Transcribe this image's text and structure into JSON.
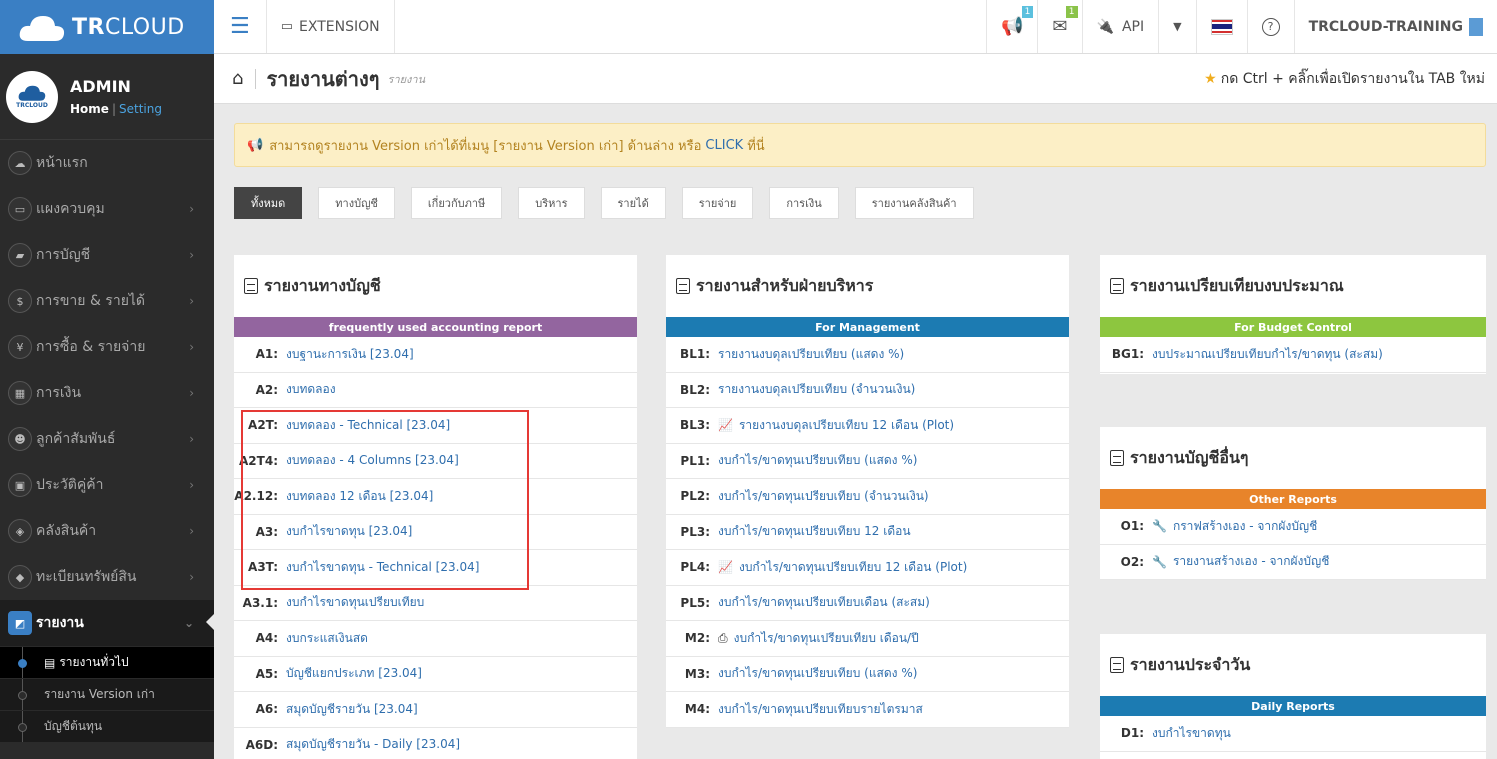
{
  "brand": {
    "bold": "TR",
    "light": "CLOUD",
    "avatar_text": "TRCLOUD"
  },
  "profile": {
    "name": "ADMIN",
    "home": "Home",
    "separator": "|",
    "setting": "Setting"
  },
  "sidebar": {
    "items": [
      {
        "label": "หน้าแรก",
        "icon": "cloud-icon",
        "glyph": "☁"
      },
      {
        "label": "แผงควบคุม",
        "icon": "monitor-icon",
        "glyph": "▭"
      },
      {
        "label": "การบัญชี",
        "icon": "book-icon",
        "glyph": "▰"
      },
      {
        "label": "การขาย & รายได้",
        "icon": "dollar-icon",
        "glyph": "$"
      },
      {
        "label": "การซื้อ & รายจ่าย",
        "icon": "yen-icon",
        "glyph": "¥"
      },
      {
        "label": "การเงิน",
        "icon": "calendar-icon",
        "glyph": "▦"
      },
      {
        "label": "ลูกค้าสัมพันธ์",
        "icon": "users-icon",
        "glyph": "☻"
      },
      {
        "label": "ประวัติคู่ค้า",
        "icon": "contact-icon",
        "glyph": "▣"
      },
      {
        "label": "คลังสินค้า",
        "icon": "cubes-icon",
        "glyph": "◈"
      },
      {
        "label": "ทะเบียนทรัพย์สิน",
        "icon": "diamond-icon",
        "glyph": "◆"
      }
    ],
    "active": {
      "label": "รายงาน",
      "icon": "report-icon",
      "glyph": "◩"
    },
    "submenu": [
      {
        "label": "รายงานทั่วไป",
        "current": true
      },
      {
        "label": "รายงาน Version เก่า",
        "current": false
      },
      {
        "label": "บัญชีต้นทุน",
        "current": false
      }
    ]
  },
  "topbar": {
    "extension": "EXTENSION",
    "announce_count": "1",
    "mail_count": "1",
    "api": "API",
    "company": "TRCLOUD-TRAINING"
  },
  "page": {
    "title": "รายงานต่างๆ",
    "subtitle": "รายงาน",
    "hint": "กด Ctrl + คลิ๊กเพื่อเปิดรายงานใน TAB ใหม่"
  },
  "notice": {
    "text": "สามารถดูรายงาน Version เก่าได้ที่เมนู [รายงาน Version เก่า] ด้านล่าง หรือ",
    "link": "CLICK",
    "tail": "ที่นี่"
  },
  "filters": [
    "ทั้งหมด",
    "ทางบัญชี",
    "เกี่ยวกับภาษี",
    "บริหาร",
    "รายได้",
    "รายจ่าย",
    "การเงิน",
    "รายงานคลังสินค้า"
  ],
  "panels": {
    "accounting": {
      "title": "รายงานทางบัญชี",
      "band": "frequently used accounting report",
      "band_color": "#93659f",
      "rows": [
        {
          "code": "A1:",
          "label": "งบฐานะการเงิน [23.04]"
        },
        {
          "code": "A2:",
          "label": "งบทดลอง"
        },
        {
          "code": "A2T:",
          "label": "งบทดลอง - Technical [23.04]"
        },
        {
          "code": "A2T4:",
          "label": "งบทดลอง - 4 Columns [23.04]"
        },
        {
          "code": "A2.12:",
          "label": "งบทดลอง 12 เดือน [23.04]"
        },
        {
          "code": "A3:",
          "label": "งบกำไรขาดทุน [23.04]"
        },
        {
          "code": "A3T:",
          "label": "งบกำไรขาดทุน - Technical [23.04]"
        },
        {
          "code": "A3.1:",
          "label": "งบกำไรขาดทุนเปรียบเทียบ"
        },
        {
          "code": "A4:",
          "label": "งบกระแสเงินสด"
        },
        {
          "code": "A5:",
          "label": "บัญชีแยกประเภท [23.04]"
        },
        {
          "code": "A6:",
          "label": "สมุดบัญชีรายวัน [23.04]"
        },
        {
          "code": "A6D:",
          "label": "สมุดบัญชีรายวัน - Daily [23.04]"
        }
      ]
    },
    "management": {
      "title": "รายงานสำหรับฝ่ายบริหาร",
      "band": "For Management",
      "band_color": "#1c7bb2",
      "rows": [
        {
          "code": "BL1:",
          "label": "รายงานงบดุลเปรียบเทียบ (แสดง %)",
          "icon": ""
        },
        {
          "code": "BL2:",
          "label": "รายงานงบดุลเปรียบเทียบ (จำนวนเงิน)",
          "icon": ""
        },
        {
          "code": "BL3:",
          "label": "รายงานงบดุลเปรียบเทียบ 12 เดือน (Plot)",
          "icon": "📈"
        },
        {
          "code": "PL1:",
          "label": "งบกำไร/ขาดทุนเปรียบเทียบ (แสดง %)",
          "icon": ""
        },
        {
          "code": "PL2:",
          "label": "งบกำไร/ขาดทุนเปรียบเทียบ (จำนวนเงิน)",
          "icon": ""
        },
        {
          "code": "PL3:",
          "label": "งบกำไร/ขาดทุนเปรียบเทียบ 12 เดือน",
          "icon": ""
        },
        {
          "code": "PL4:",
          "label": "งบกำไร/ขาดทุนเปรียบเทียบ 12 เดือน (Plot)",
          "icon": "📈"
        },
        {
          "code": "PL5:",
          "label": "งบกำไร/ขาดทุนเปรียบเทียบเดือน (สะสม)",
          "icon": ""
        },
        {
          "code": "M2:",
          "label": "งบกำไร/ขาดทุนเปรียบเทียบ เดือน/ปี",
          "icon": "⎙"
        },
        {
          "code": "M3:",
          "label": "งบกำไร/ขาดทุนเปรียบเทียบ (แสดง %)",
          "icon": ""
        },
        {
          "code": "M4:",
          "label": "งบกำไร/ขาดทุนเปรียบเทียบรายไตรมาส",
          "icon": ""
        }
      ]
    },
    "budget": {
      "title": "รายงานเปรียบเทียบงบประมาณ",
      "band": "For Budget Control",
      "band_color": "#8dc63f",
      "rows": [
        {
          "code": "BG1:",
          "label": "งบประมาณเปรียบเทียบกำไร/ขาดทุน (สะสม)"
        }
      ]
    },
    "other": {
      "title": "รายงานบัญชีอื่นๆ",
      "band": "Other Reports",
      "band_color": "#e8842a",
      "rows": [
        {
          "code": "O1:",
          "label": "กราฟสร้างเอง - จากผังบัญชี"
        },
        {
          "code": "O2:",
          "label": "รายงานสร้างเอง - จากผังบัญชี"
        }
      ]
    },
    "daily": {
      "title": "รายงานประจำวัน",
      "band": "Daily Reports",
      "band_color": "#1c7bb2",
      "rows": [
        {
          "code": "D1:",
          "label": "งบกำไรขาดทุน"
        }
      ]
    }
  }
}
